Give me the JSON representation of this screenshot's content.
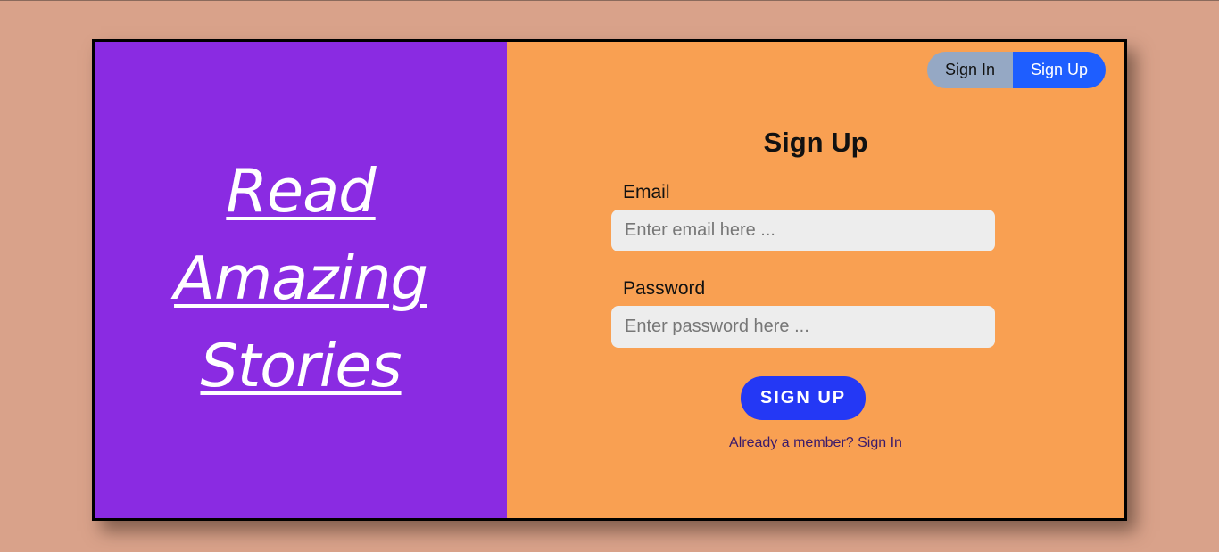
{
  "hero": {
    "line1": "Read Amazing",
    "line2": "Stories"
  },
  "toggle": {
    "signin_label": "Sign In",
    "signup_label": "Sign Up",
    "active": "signup"
  },
  "form": {
    "title": "Sign Up",
    "email_label": "Email",
    "email_placeholder": "Enter email here ...",
    "email_value": "",
    "password_label": "Password",
    "password_placeholder": "Enter password here ...",
    "password_value": "",
    "submit_label": "SIGN UP",
    "switch_prefix": "Already a member?",
    "switch_link": "Sign In"
  },
  "colors": {
    "page_bg": "#d9a28a",
    "left_panel": "#8a2be2",
    "right_panel": "#f9a052",
    "toggle_inactive": "#95a8c4",
    "toggle_active": "#1e5eff",
    "submit_button": "#2438f5",
    "input_bg": "#ededed"
  }
}
